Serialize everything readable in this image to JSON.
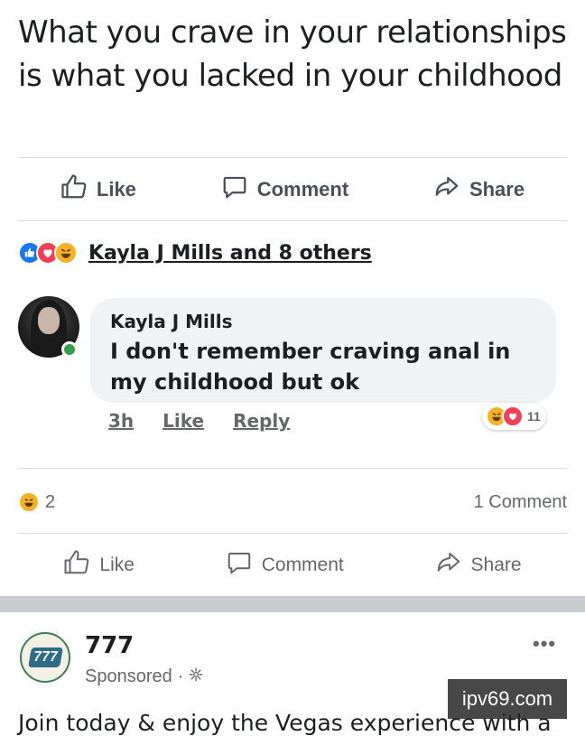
{
  "post": {
    "text": "What you crave in your relationships is what you lacked in your childhood",
    "actions": {
      "like": "Like",
      "comment": "Comment",
      "share": "Share"
    },
    "reactions_names": "Kayla J Mills and 8 others"
  },
  "comment": {
    "author": "Kayla J Mills",
    "text": "I don't remember craving anal in my childhood but ok",
    "time": "3h",
    "like": "Like",
    "reply": "Reply",
    "reaction_count": "11"
  },
  "summary": {
    "reaction_count": "2",
    "comments": "1 Comment"
  },
  "bottom_actions": {
    "like": "Like",
    "comment": "Comment",
    "share": "Share"
  },
  "ad": {
    "logo_text": "777",
    "name": "777",
    "sponsored": "Sponsored",
    "text": "Join today & enjoy the Vegas experience with a"
  },
  "watermark": "ipv69.com",
  "colors": {
    "like_blue": "#1877f2",
    "love_red": "#f33e58",
    "haha_yellow": "#f7b125",
    "online_green": "#31a24c"
  }
}
